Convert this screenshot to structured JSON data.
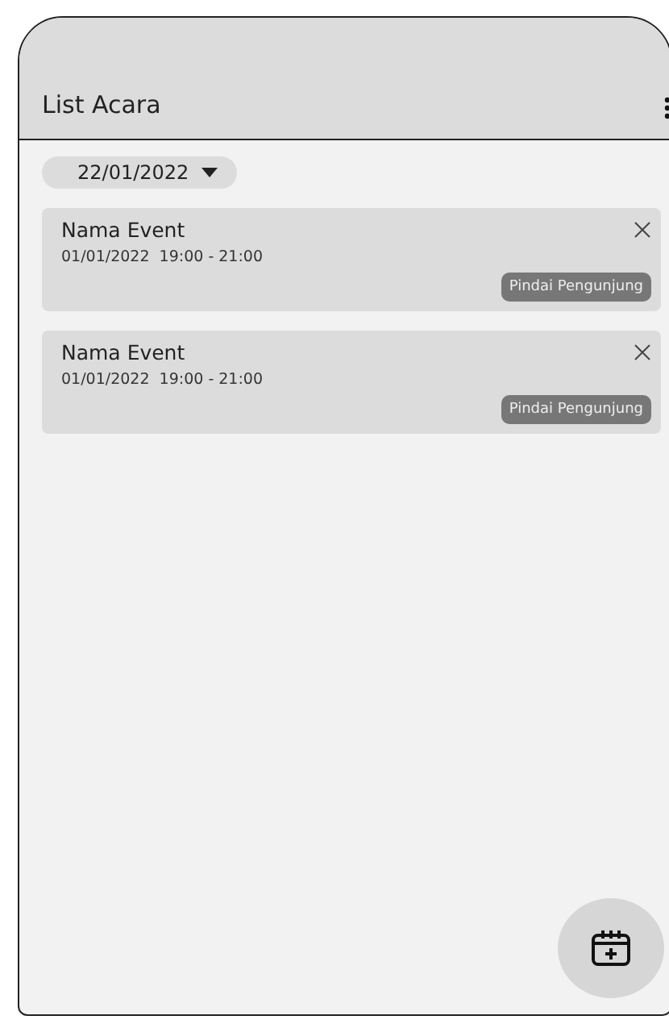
{
  "header": {
    "title": "List Acara"
  },
  "date_filter": {
    "value": "22/01/2022"
  },
  "events": [
    {
      "name": "Nama Event",
      "date": "01/01/2022",
      "time": "19:00 - 21:00",
      "action": "Pindai Pengunjung"
    },
    {
      "name": "Nama Event",
      "date": "01/01/2022",
      "time": "19:00 - 21:00",
      "action": "Pindai Pengunjung"
    }
  ]
}
